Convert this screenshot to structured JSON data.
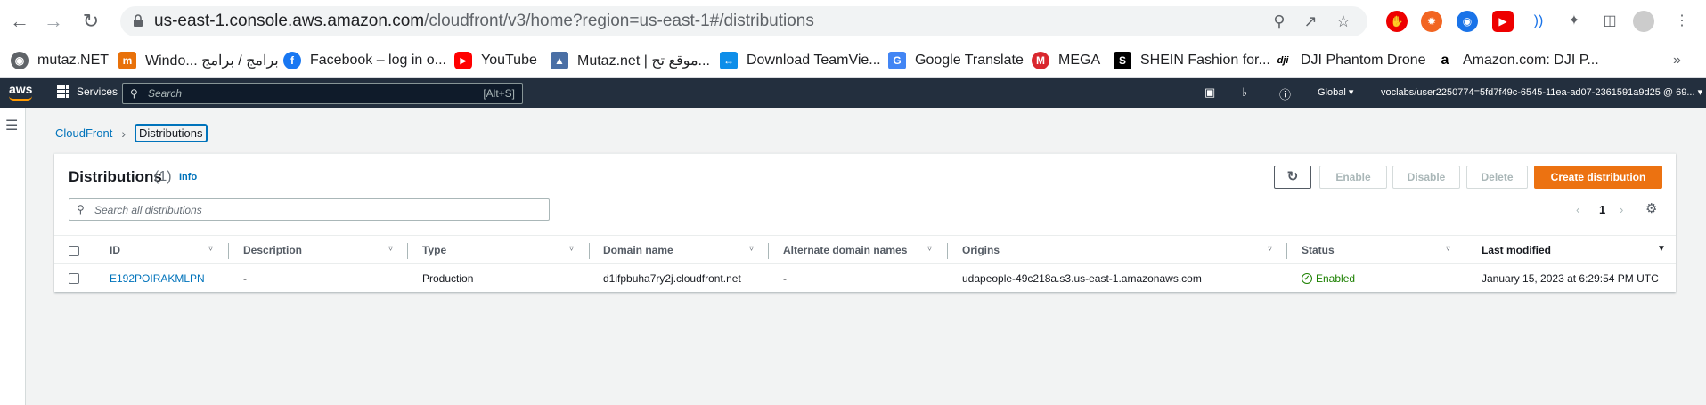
{
  "browser": {
    "url_host": "us-east-1.console.aws.amazon.com",
    "url_path": "/cloudfront/v3/home?region=us-east-1#/distributions",
    "bookmarks": [
      {
        "label": "mutaz.NET",
        "icon": "globe-icon",
        "color": "#5f6368"
      },
      {
        "label": "Windo... برامج / برامج",
        "icon": "windows-app-icon",
        "color": "#e8710a"
      },
      {
        "label": "Facebook – log in o...",
        "icon": "facebook-icon",
        "color": "#1877f2"
      },
      {
        "label": "YouTube",
        "icon": "youtube-icon",
        "color": "#ff0000"
      },
      {
        "label": "Mutaz.net | موقع تج...",
        "icon": "mutaz-icon",
        "color": "#4a6fa5"
      },
      {
        "label": "Download TeamVie...",
        "icon": "teamviewer-icon",
        "color": "#0e8ee9"
      },
      {
        "label": "Google Translate",
        "icon": "google-translate-icon",
        "color": "#4285f4"
      },
      {
        "label": "MEGA",
        "icon": "mega-icon",
        "color": "#d9272e"
      },
      {
        "label": "SHEIN Fashion for...",
        "icon": "shein-icon",
        "color": "#000000"
      },
      {
        "label": "DJI Phantom Drone",
        "icon": "dji-icon",
        "color": "#000000"
      },
      {
        "label": "Amazon.com: DJI P...",
        "icon": "amazon-icon",
        "color": "#000000"
      }
    ]
  },
  "aws_header": {
    "logo": "aws",
    "services_label": "Services",
    "search_placeholder": "Search",
    "search_shortcut": "[Alt+S]",
    "region_label": "Global",
    "account_label": "voclabs/user2250774=5fd7f49c-6545-11ea-ad07-2361591a9d25 @ 69..."
  },
  "breadcrumb": {
    "parent": "CloudFront",
    "current": "Distributions"
  },
  "panel": {
    "title": "Distributions",
    "count": "(1)",
    "info_label": "Info",
    "enable_label": "Enable",
    "disable_label": "Disable",
    "delete_label": "Delete",
    "create_label": "Create distribution",
    "search_placeholder": "Search all distributions",
    "page_number": "1"
  },
  "table": {
    "columns": [
      "ID",
      "Description",
      "Type",
      "Domain name",
      "Alternate domain names",
      "Origins",
      "Status",
      "Last modified"
    ],
    "rows": [
      {
        "id": "E192POIRAKMLPN",
        "description": "-",
        "type": "Production",
        "domain": "d1ifpbuha7ry2j.cloudfront.net",
        "alternate": "-",
        "origins": "udapeople-49c218a.s3.us-east-1.amazonaws.com",
        "status": "Enabled",
        "last_modified": "January 15, 2023 at 6:29:54 PM UTC"
      }
    ]
  },
  "colors": {
    "aws_header": "#232f3e",
    "link": "#0073bb",
    "primary_button": "#ec7211",
    "status_ok": "#1d8102"
  }
}
